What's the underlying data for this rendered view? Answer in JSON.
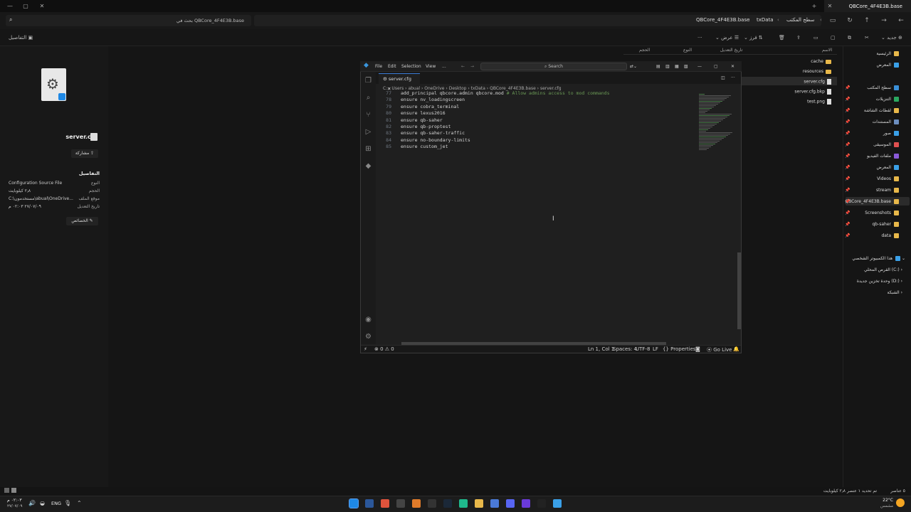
{
  "window": {
    "tab_title": "QBCore_4F4E3B.base"
  },
  "address": {
    "search_placeholder": "بحث في QBCore_4F4E3B.base",
    "breadcrumbs": [
      "QBCore_4F4E3B.base",
      "txData",
      "سطح المكتب"
    ]
  },
  "toolbar": {
    "new": "جديد",
    "sort": "فرز",
    "view": "عرض",
    "details": "التفاصيل"
  },
  "details": {
    "filename": "server.cfg",
    "share": "مشاركة",
    "section": "التفاصيل",
    "rows": [
      {
        "label": "النوع",
        "value": "Configuration Source File"
      },
      {
        "label": "الحجم",
        "value": "٢٫٨ كيلوبايت"
      },
      {
        "label": "موقع الملف",
        "value": "C:\\مستخدمون\\abual\\OneDrive..."
      },
      {
        "label": "تاريخ التعديل",
        "value": "٢٧/٠٧/٠٩ ٠٢:٠٣ م"
      }
    ],
    "properties": "الخصائص"
  },
  "filelist": {
    "headers": [
      "الاسم",
      "تاريخ التعديل",
      "النوع",
      "الحجم"
    ],
    "items": [
      {
        "name": "cache",
        "kind": "folder"
      },
      {
        "name": "resources",
        "kind": "folder"
      },
      {
        "name": "server.cfg",
        "kind": "file"
      },
      {
        "name": "server.cfg.bkp",
        "kind": "file"
      },
      {
        "name": "test.png",
        "kind": "file"
      }
    ]
  },
  "nav": {
    "top": [
      {
        "label": "الرئيسية",
        "color": "#e8b84a"
      },
      {
        "label": "المعرض",
        "color": "#3aa0e8"
      }
    ],
    "pinned": [
      {
        "label": "سطح المكتب",
        "color": "#3a8fd8"
      },
      {
        "label": "التنزيلات",
        "color": "#2aa860"
      },
      {
        "label": "لقطات الشاشة",
        "color": "#e8b84a"
      },
      {
        "label": "المستندات",
        "color": "#6c8ebf"
      },
      {
        "label": "صور",
        "color": "#3aa0e8"
      },
      {
        "label": "الموسيقى",
        "color": "#e05050"
      },
      {
        "label": "ملفات الفيديو",
        "color": "#8a5ad8"
      },
      {
        "label": "المعرض",
        "color": "#3aa0e8"
      },
      {
        "label": "Videos",
        "color": "#e8b84a"
      },
      {
        "label": "stream",
        "color": "#e8b84a"
      },
      {
        "label": "QBCore_4F4E3B.base",
        "color": "#e8b84a"
      },
      {
        "label": "Screenshots",
        "color": "#e8b84a"
      },
      {
        "label": "qb-saher",
        "color": "#e8b84a"
      },
      {
        "label": "data",
        "color": "#e8b84a"
      }
    ],
    "pc": "هذا الكمبيوتر الشخصي",
    "drives": [
      "القرص المحلي (C:)",
      "وحدة تخزين جديدة (D:)",
      "الشبكة"
    ]
  },
  "status": {
    "left": "٥ عناصر",
    "mid": "تم تحديد ١ عنصر ٢٫٨ كيلوبايت"
  },
  "vscode": {
    "menu": [
      "File",
      "Edit",
      "Selection",
      "View",
      "..."
    ],
    "search": "Search",
    "tab": "server.cfg",
    "breadcrumb": "C: › Users › abual › OneDrive › Desktop › txData › QBCore_4F4E3B.base › server.cfg",
    "lines": [
      {
        "n": "77",
        "t": "add_principal qbcore.admin qbcore.mod ",
        "c": "# Allow admins access to mod commands"
      },
      {
        "n": "78",
        "t": "ensure nv_loadingscreen",
        "c": ""
      },
      {
        "n": "79",
        "t": "ensure cobra_terminal",
        "c": ""
      },
      {
        "n": "80",
        "t": "ensure lexus2016",
        "c": ""
      },
      {
        "n": "81",
        "t": "ensure qb-saher",
        "c": ""
      },
      {
        "n": "82",
        "t": "ensure qb-proptest",
        "c": ""
      },
      {
        "n": "83",
        "t": "ensure qb-saher-traffic",
        "c": ""
      },
      {
        "n": "84",
        "t": "ensure no-boundary-limits",
        "c": ""
      },
      {
        "n": "85",
        "t": "ensure custom_jet",
        "c": ""
      }
    ],
    "status": {
      "errors": "0",
      "warnings": "0",
      "position": "Ln 1, Col 1",
      "spaces": "Spaces: 4",
      "encoding": "UTF-8",
      "eol": "LF",
      "lang": "Properties",
      "golive": "Go Live"
    }
  },
  "taskbar": {
    "weather": "22°C",
    "weather_desc": "مشمس",
    "lang": "ENG",
    "time": "٠٢:٠٣ م",
    "date": "٢٧/٠٧/٠٩"
  }
}
